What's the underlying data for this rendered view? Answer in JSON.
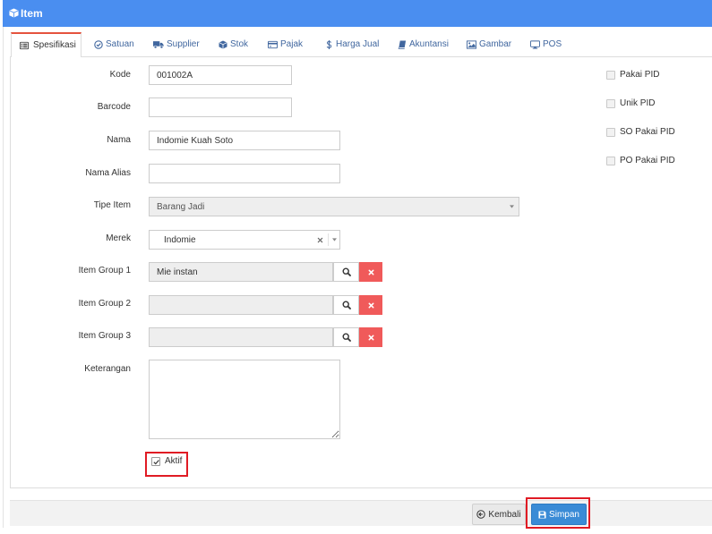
{
  "header": {
    "icon": "cube-icon",
    "title": "Item"
  },
  "tabs": [
    {
      "icon": "list-alt-icon",
      "label": "Spesifikasi",
      "active": true
    },
    {
      "icon": "check-circle-icon",
      "label": "Satuan",
      "active": false
    },
    {
      "icon": "truck-icon",
      "label": "Supplier",
      "active": false
    },
    {
      "icon": "cube-icon",
      "label": "Stok",
      "active": false
    },
    {
      "icon": "credit-card-icon",
      "label": "Pajak",
      "active": false
    },
    {
      "icon": "dollar-icon",
      "label": "Harga Jual",
      "active": false
    },
    {
      "icon": "book-icon",
      "label": "Akuntansi",
      "active": false
    },
    {
      "icon": "image-icon",
      "label": "Gambar",
      "active": false
    },
    {
      "icon": "desktop-icon",
      "label": "POS",
      "active": false
    }
  ],
  "form": {
    "kode": {
      "label": "Kode",
      "value": "001002A"
    },
    "barcode": {
      "label": "Barcode",
      "value": ""
    },
    "nama": {
      "label": "Nama",
      "value": "Indomie Kuah Soto"
    },
    "nama_alias": {
      "label": "Nama Alias",
      "value": ""
    },
    "tipe_item": {
      "label": "Tipe Item",
      "value": "Barang Jadi"
    },
    "merek": {
      "label": "Merek",
      "value": "Indomie"
    },
    "item_group_1": {
      "label": "Item Group 1",
      "value": "Mie instan"
    },
    "item_group_2": {
      "label": "Item Group 2",
      "value": ""
    },
    "item_group_3": {
      "label": "Item Group 3",
      "value": ""
    },
    "keterangan": {
      "label": "Keterangan",
      "value": ""
    },
    "aktif": {
      "label": "Aktif",
      "checked": true
    }
  },
  "options": [
    {
      "label": "Pakai PID",
      "checked": false
    },
    {
      "label": "Unik PID",
      "checked": false
    },
    {
      "label": "SO Pakai PID",
      "checked": false
    },
    {
      "label": "PO Pakai PID",
      "checked": false
    }
  ],
  "footer": {
    "back_label": "Kembali",
    "back_icon": "arrow-circle-left-icon",
    "save_label": "Simpan",
    "save_icon": "save-icon"
  },
  "colors": {
    "header": "#4a8ef0",
    "active_tab_accent": "#e5533d",
    "save_button": "#3a8bd6",
    "delete_button": "#f05a5a",
    "highlight": "#e01b24"
  }
}
